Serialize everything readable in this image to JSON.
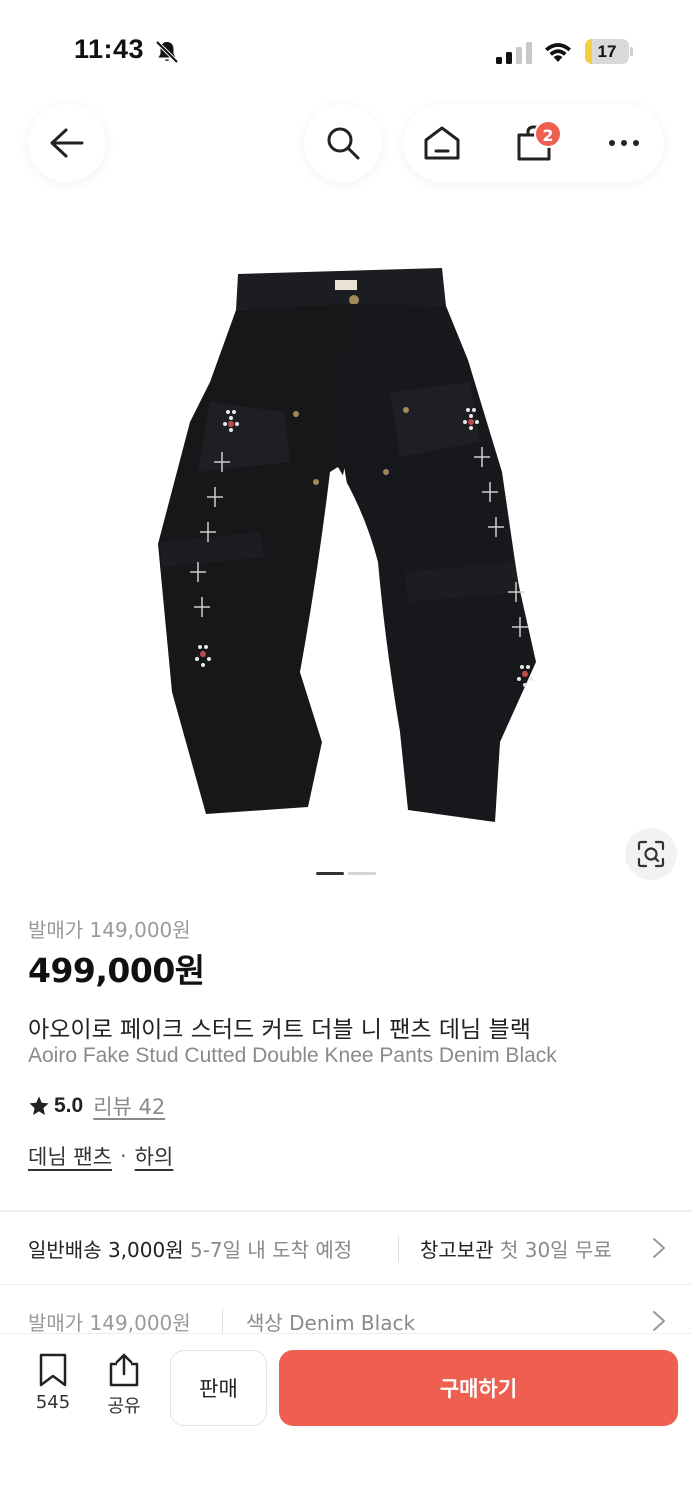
{
  "status_bar": {
    "time": "11:43",
    "battery": "17",
    "battery_level": 0.17,
    "icons": [
      "bell-off-icon",
      "signal-icon",
      "wifi-icon",
      "battery-icon"
    ]
  },
  "nav": {
    "icons": [
      "back-arrow-icon",
      "search-icon",
      "home-icon",
      "cart-icon",
      "more-icon"
    ],
    "cart_count": "2"
  },
  "product": {
    "image_icon": "black-denim-pants-photo",
    "image_count": 2,
    "image_index": 1,
    "release_price": "발매가 149,000원",
    "price": "499,000원",
    "title_ko": "아오이로 페이크 스터드 커트 더블 니 팬츠 데님 블랙",
    "title_en": "Aoiro Fake Stud Cutted Double Knee Pants Denim Black",
    "rating": "5.0",
    "review": "리뷰 42",
    "category": "데님 팬츠",
    "subcategory": "하의",
    "category_sep": "·"
  },
  "shipping": {
    "main": "일반배송 3,000원",
    "sub": "5-7일 내 도착 예정",
    "storage_main": "창고보관",
    "storage_sub": "첫 30일 무료"
  },
  "options": {
    "release": "발매가 149,000원",
    "color": "색상 Denim Black"
  },
  "bottom_bar": {
    "bookmark_count": "545",
    "share_label": "공유",
    "sell_label": "판매",
    "buy_label": "구매하기"
  },
  "colors": {
    "accent": "#ee5f4f",
    "battery": "#f4d03f"
  }
}
